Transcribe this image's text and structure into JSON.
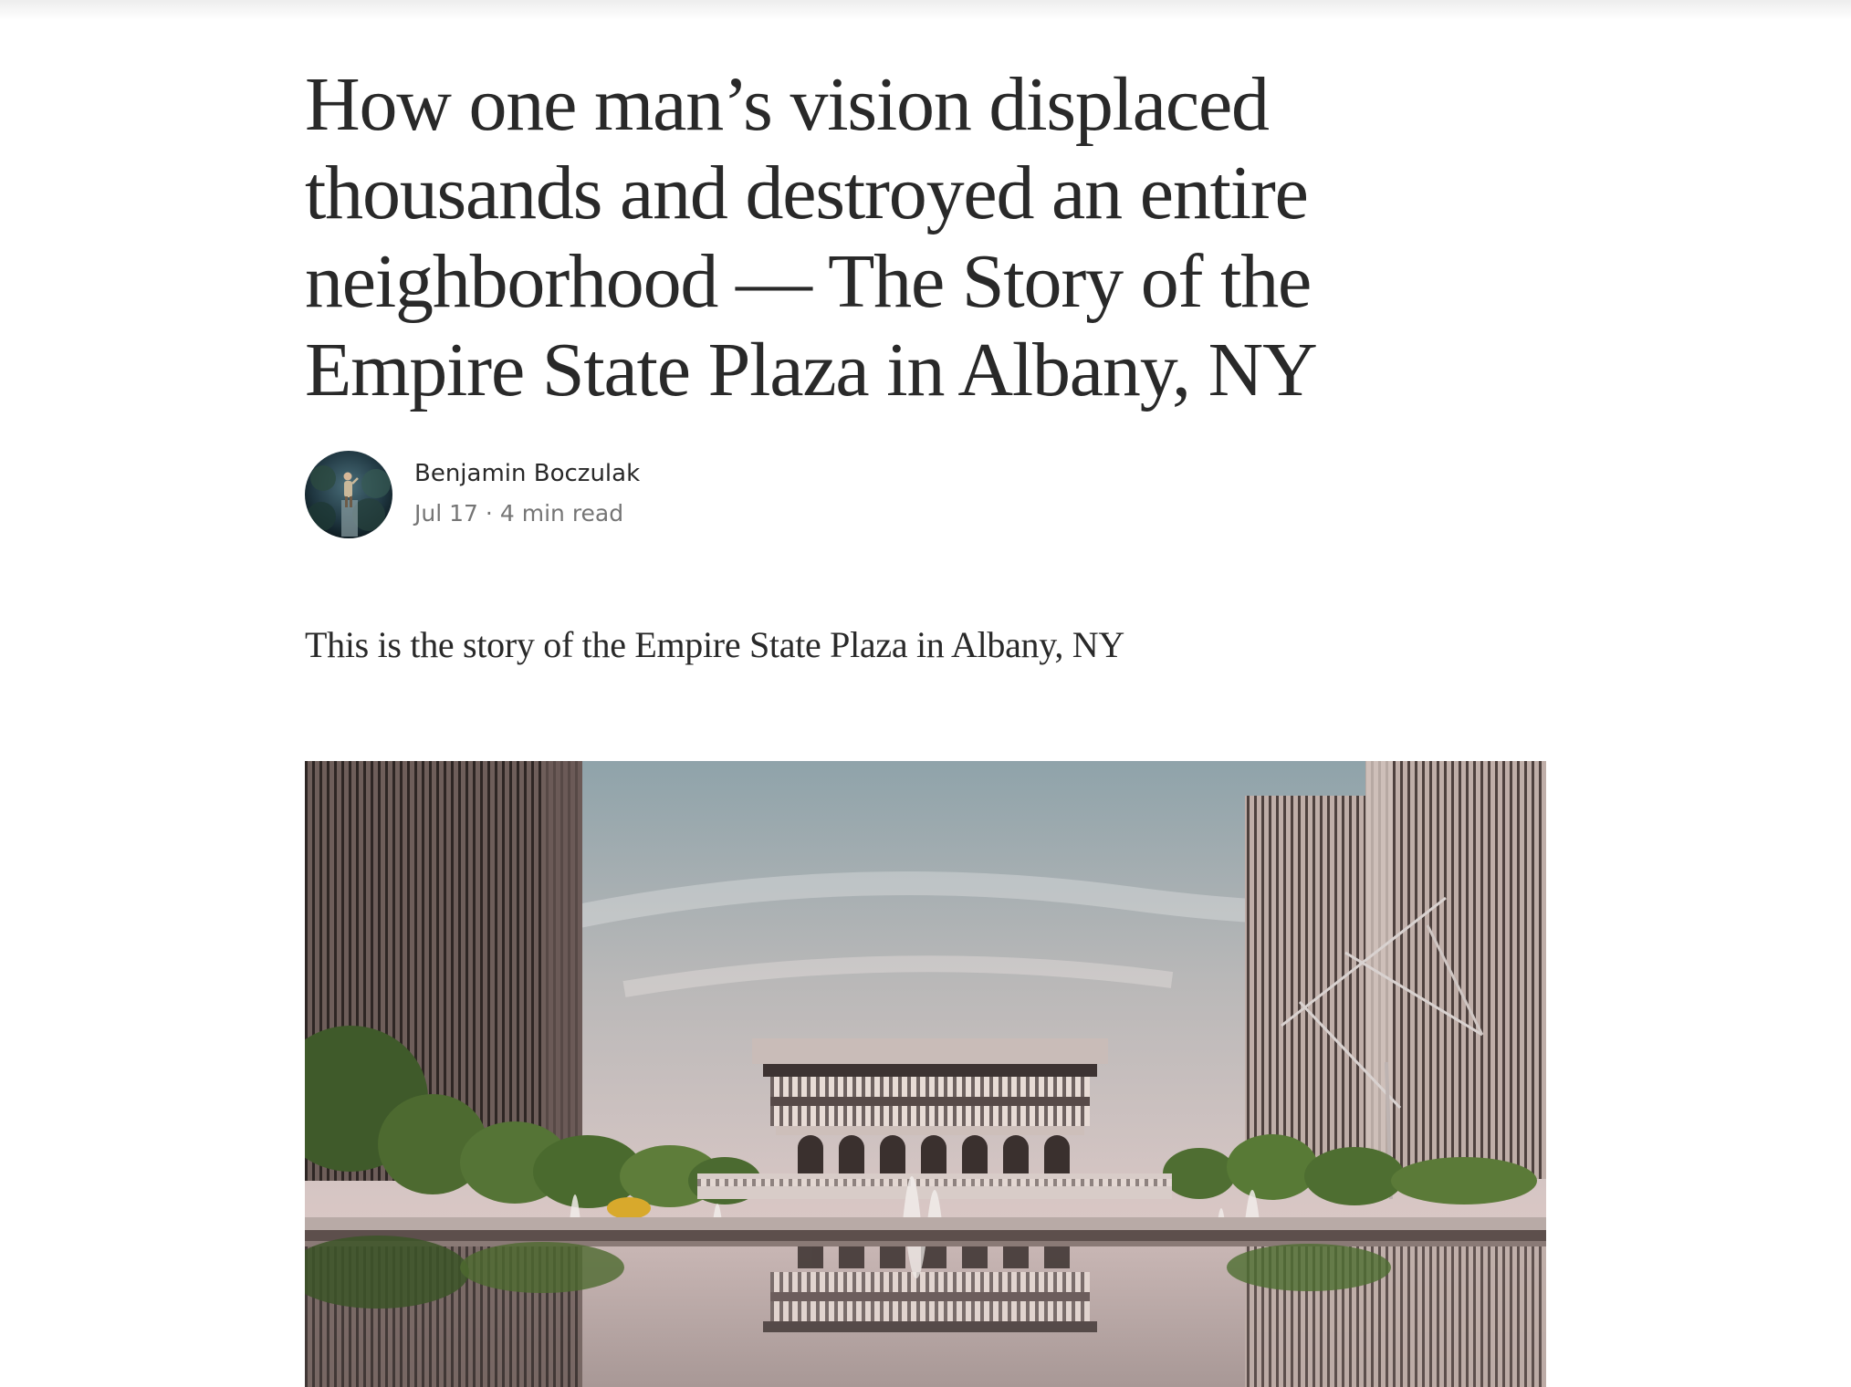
{
  "article": {
    "title": "How one man’s vision displaced thousands and destroyed an entire neighborhood — The Story of the Empire State Plaza in Albany, NY",
    "author": {
      "name": "Benjamin Boczulak",
      "avatar_icon": "author-photo"
    },
    "meta": {
      "date": "Jul 17",
      "separator": "·",
      "read_time": "4 min read"
    },
    "intro": "This is the story of the Empire State Plaza in Albany, NY",
    "hero_image": {
      "icon": "empire-state-plaza-photo"
    }
  },
  "colors": {
    "text": "#292929",
    "muted": "#757575",
    "background": "#ffffff"
  }
}
